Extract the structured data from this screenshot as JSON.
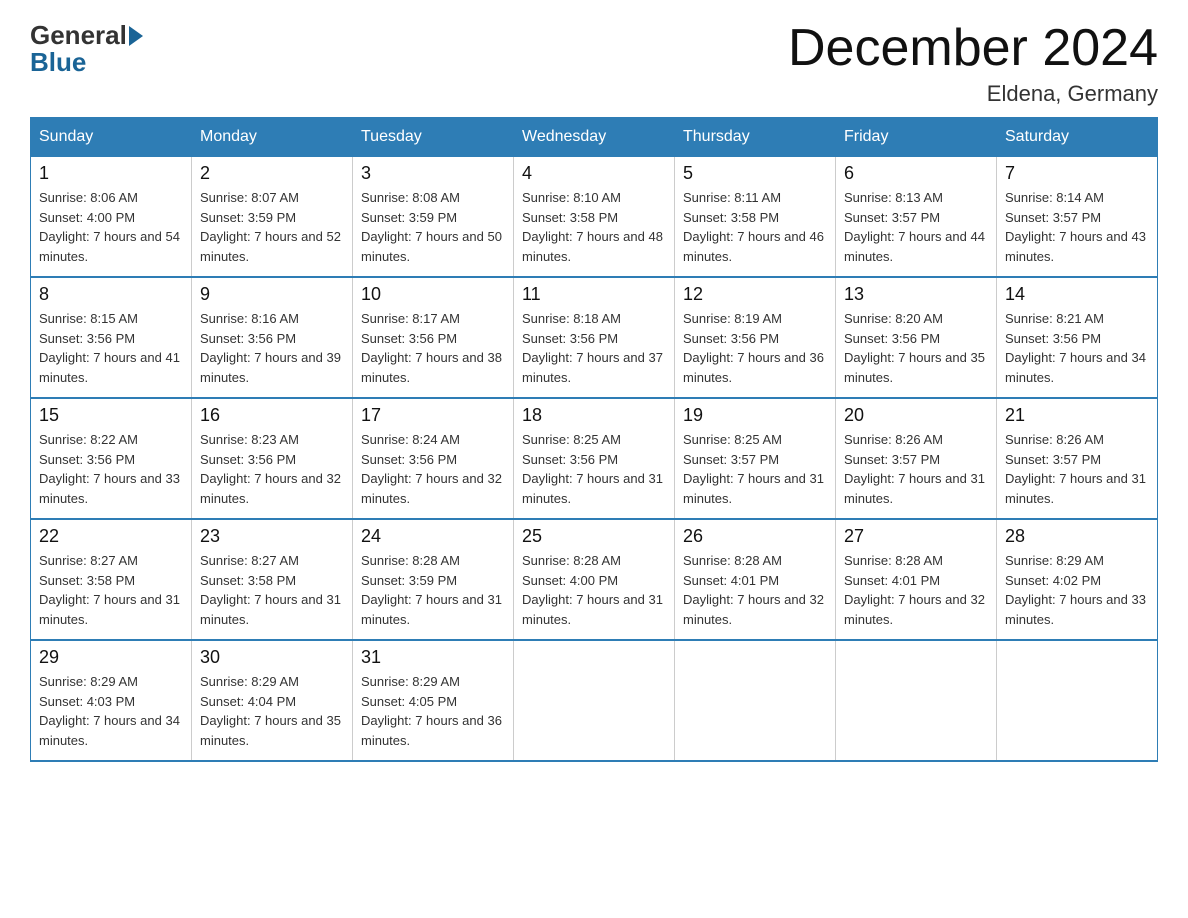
{
  "logo": {
    "general": "General",
    "blue": "Blue"
  },
  "title": "December 2024",
  "location": "Eldena, Germany",
  "days_of_week": [
    "Sunday",
    "Monday",
    "Tuesday",
    "Wednesday",
    "Thursday",
    "Friday",
    "Saturday"
  ],
  "weeks": [
    [
      {
        "day": "1",
        "sunrise": "8:06 AM",
        "sunset": "4:00 PM",
        "daylight": "7 hours and 54 minutes."
      },
      {
        "day": "2",
        "sunrise": "8:07 AM",
        "sunset": "3:59 PM",
        "daylight": "7 hours and 52 minutes."
      },
      {
        "day": "3",
        "sunrise": "8:08 AM",
        "sunset": "3:59 PM",
        "daylight": "7 hours and 50 minutes."
      },
      {
        "day": "4",
        "sunrise": "8:10 AM",
        "sunset": "3:58 PM",
        "daylight": "7 hours and 48 minutes."
      },
      {
        "day": "5",
        "sunrise": "8:11 AM",
        "sunset": "3:58 PM",
        "daylight": "7 hours and 46 minutes."
      },
      {
        "day": "6",
        "sunrise": "8:13 AM",
        "sunset": "3:57 PM",
        "daylight": "7 hours and 44 minutes."
      },
      {
        "day": "7",
        "sunrise": "8:14 AM",
        "sunset": "3:57 PM",
        "daylight": "7 hours and 43 minutes."
      }
    ],
    [
      {
        "day": "8",
        "sunrise": "8:15 AM",
        "sunset": "3:56 PM",
        "daylight": "7 hours and 41 minutes."
      },
      {
        "day": "9",
        "sunrise": "8:16 AM",
        "sunset": "3:56 PM",
        "daylight": "7 hours and 39 minutes."
      },
      {
        "day": "10",
        "sunrise": "8:17 AM",
        "sunset": "3:56 PM",
        "daylight": "7 hours and 38 minutes."
      },
      {
        "day": "11",
        "sunrise": "8:18 AM",
        "sunset": "3:56 PM",
        "daylight": "7 hours and 37 minutes."
      },
      {
        "day": "12",
        "sunrise": "8:19 AM",
        "sunset": "3:56 PM",
        "daylight": "7 hours and 36 minutes."
      },
      {
        "day": "13",
        "sunrise": "8:20 AM",
        "sunset": "3:56 PM",
        "daylight": "7 hours and 35 minutes."
      },
      {
        "day": "14",
        "sunrise": "8:21 AM",
        "sunset": "3:56 PM",
        "daylight": "7 hours and 34 minutes."
      }
    ],
    [
      {
        "day": "15",
        "sunrise": "8:22 AM",
        "sunset": "3:56 PM",
        "daylight": "7 hours and 33 minutes."
      },
      {
        "day": "16",
        "sunrise": "8:23 AM",
        "sunset": "3:56 PM",
        "daylight": "7 hours and 32 minutes."
      },
      {
        "day": "17",
        "sunrise": "8:24 AM",
        "sunset": "3:56 PM",
        "daylight": "7 hours and 32 minutes."
      },
      {
        "day": "18",
        "sunrise": "8:25 AM",
        "sunset": "3:56 PM",
        "daylight": "7 hours and 31 minutes."
      },
      {
        "day": "19",
        "sunrise": "8:25 AM",
        "sunset": "3:57 PM",
        "daylight": "7 hours and 31 minutes."
      },
      {
        "day": "20",
        "sunrise": "8:26 AM",
        "sunset": "3:57 PM",
        "daylight": "7 hours and 31 minutes."
      },
      {
        "day": "21",
        "sunrise": "8:26 AM",
        "sunset": "3:57 PM",
        "daylight": "7 hours and 31 minutes."
      }
    ],
    [
      {
        "day": "22",
        "sunrise": "8:27 AM",
        "sunset": "3:58 PM",
        "daylight": "7 hours and 31 minutes."
      },
      {
        "day": "23",
        "sunrise": "8:27 AM",
        "sunset": "3:58 PM",
        "daylight": "7 hours and 31 minutes."
      },
      {
        "day": "24",
        "sunrise": "8:28 AM",
        "sunset": "3:59 PM",
        "daylight": "7 hours and 31 minutes."
      },
      {
        "day": "25",
        "sunrise": "8:28 AM",
        "sunset": "4:00 PM",
        "daylight": "7 hours and 31 minutes."
      },
      {
        "day": "26",
        "sunrise": "8:28 AM",
        "sunset": "4:01 PM",
        "daylight": "7 hours and 32 minutes."
      },
      {
        "day": "27",
        "sunrise": "8:28 AM",
        "sunset": "4:01 PM",
        "daylight": "7 hours and 32 minutes."
      },
      {
        "day": "28",
        "sunrise": "8:29 AM",
        "sunset": "4:02 PM",
        "daylight": "7 hours and 33 minutes."
      }
    ],
    [
      {
        "day": "29",
        "sunrise": "8:29 AM",
        "sunset": "4:03 PM",
        "daylight": "7 hours and 34 minutes."
      },
      {
        "day": "30",
        "sunrise": "8:29 AM",
        "sunset": "4:04 PM",
        "daylight": "7 hours and 35 minutes."
      },
      {
        "day": "31",
        "sunrise": "8:29 AM",
        "sunset": "4:05 PM",
        "daylight": "7 hours and 36 minutes."
      },
      null,
      null,
      null,
      null
    ]
  ]
}
